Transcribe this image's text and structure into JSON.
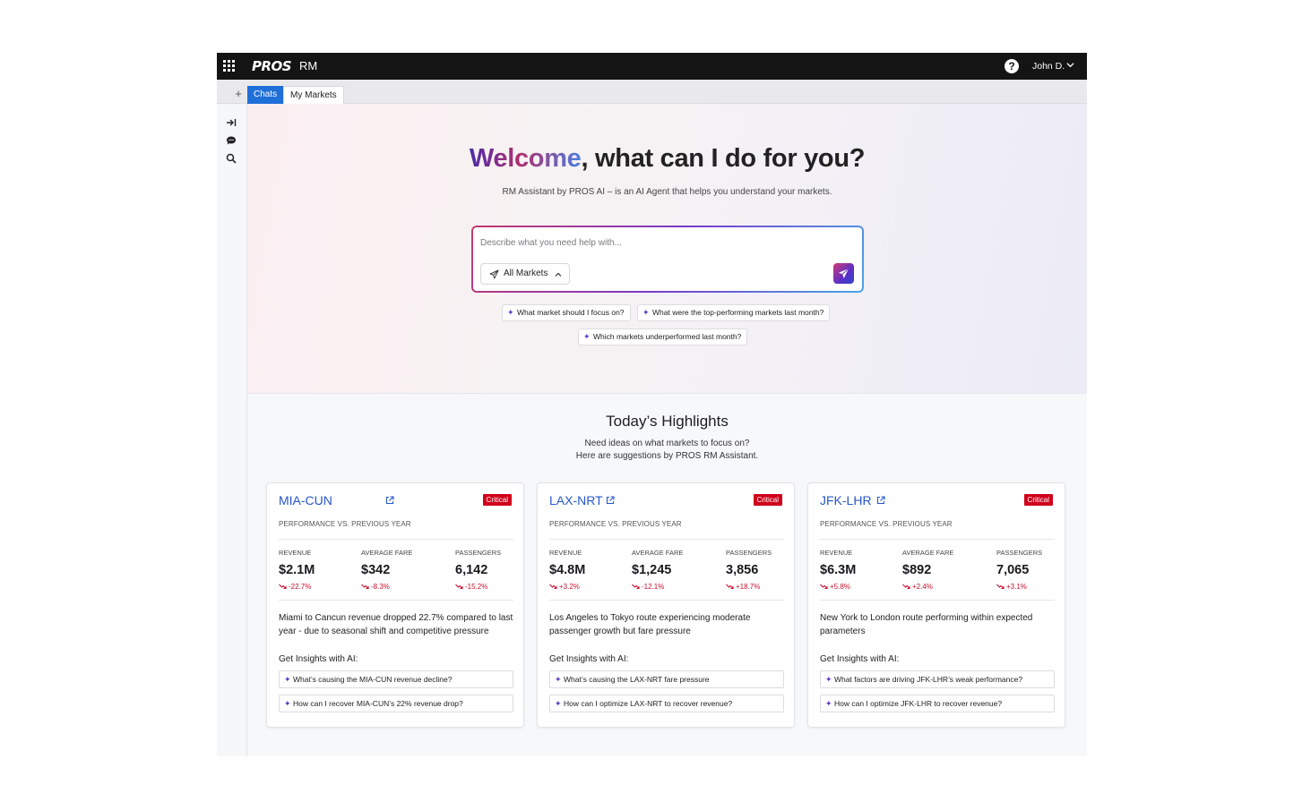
{
  "topbar": {
    "logo": "PROS",
    "product": "RM",
    "help_symbol": "?",
    "user_name": "John D."
  },
  "tabs": {
    "add_symbol": "+",
    "items": [
      {
        "label": "Chats",
        "active": true
      },
      {
        "label": "My Markets",
        "active": false
      }
    ]
  },
  "sidebar": {
    "icons": [
      "collapse-arrow-icon",
      "chat-bubble-icon",
      "search-icon"
    ]
  },
  "hero": {
    "title_highlight": "Welcome",
    "title_rest": ", what can I do for you?",
    "subtitle": "RM Assistant by PROS AI – is an AI Agent that helps you understand your markets.",
    "prompt_placeholder": "Describe what you need help with...",
    "market_selector": "All Markets",
    "suggestions": [
      "What market should I focus on?",
      "What were the top-performing markets last month?",
      "Which markets underperformed last month?"
    ]
  },
  "highlights": {
    "title": "Today’s Highlights",
    "subtitle_line1": "Need ideas on what markets to focus on?",
    "subtitle_line2": "Here are suggestions by PROS RM Assistant."
  },
  "colors": {
    "accent_blue": "#1f6fd8",
    "route_link": "#2657c9",
    "critical_red": "#d0021b",
    "negative_change": "#c8102e",
    "topbar_bg": "#141414"
  },
  "cards": [
    {
      "route": "MIA-CUN",
      "badge": "Critical",
      "caption": "PERFORMANCE VS. PREVIOUS YEAR",
      "metrics": [
        {
          "label": "REVENUE",
          "value": "$2.1M",
          "change": "-22.7%"
        },
        {
          "label": "AVERAGE FARE",
          "value": "$342",
          "change": "-8.3%"
        },
        {
          "label": "PASSENGERS",
          "value": "6,142",
          "change": "-15.2%"
        }
      ],
      "description": "Miami to Cancun revenue dropped 22.7% compared to last year - due to seasonal shift and competitive pressure",
      "insights_label": "Get Insights with AI:",
      "insights": [
        "What’s causing the MIA-CUN revenue decline?",
        "How can I recover MIA-CUN’s 22% revenue drop?"
      ]
    },
    {
      "route": "LAX-NRT",
      "badge": "Critical",
      "caption": "PERFORMANCE VS. PREVIOUS YEAR",
      "metrics": [
        {
          "label": "REVENUE",
          "value": "$4.8M",
          "change": "+3.2%"
        },
        {
          "label": "AVERAGE FARE",
          "value": "$1,245",
          "change": "-12.1%"
        },
        {
          "label": "PASSENGERS",
          "value": "3,856",
          "change": "+18.7%"
        }
      ],
      "description": "Los Angeles to Tokyo route experiencing moderate passenger growth but fare pressure",
      "insights_label": "Get Insights with AI:",
      "insights": [
        "What’s causing the LAX-NRT fare pressure",
        "How can I optimize LAX-NRT to recover revenue?"
      ]
    },
    {
      "route": "JFK-LHR",
      "badge": "Critical",
      "caption": "PERFORMANCE VS. PREVIOUS YEAR",
      "metrics": [
        {
          "label": "REVENUE",
          "value": "$6.3M",
          "change": "+5.8%"
        },
        {
          "label": "AVERAGE FARE",
          "value": "$892",
          "change": "+2.4%"
        },
        {
          "label": "PASSENGERS",
          "value": "7,065",
          "change": "+3.1%"
        }
      ],
      "description": "New York to London route performing within expected parameters",
      "insights_label": "Get Insights with AI:",
      "insights": [
        "What factors are driving JFK-LHR’s weak performance?",
        "How can I optimize JFK-LHR to recover revenue?"
      ]
    }
  ]
}
